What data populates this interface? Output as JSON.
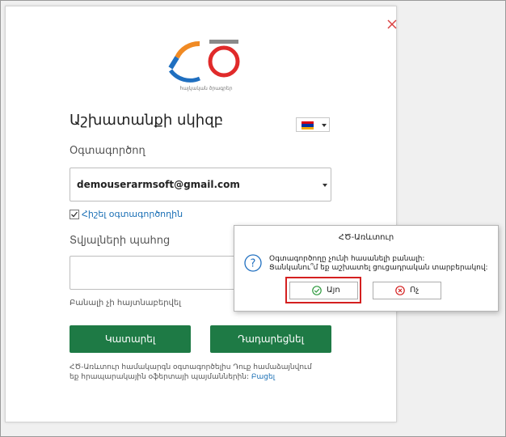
{
  "login": {
    "title": "Աշխատանքի սկիզբ",
    "user_label": "Օգտագործող",
    "user_value": "demouserarmsoft@gmail.com",
    "remember_label": "Հիշել օգտագործողին",
    "remember_checked": true,
    "password_label": "Տվյալների պահոց",
    "password_value": "",
    "hint": "Բանալի չի հայտնաբերվել",
    "login_button": "Կատարել",
    "connect_button": "Դադարեցնել",
    "footer_text": "ՀԾ-Առևտուր համակարգն օգտագործելիս Դուք համաձայնվում եք հրապարակային օֆերտայի պայմաններին:",
    "footer_link": "Բացել"
  },
  "logo": {
    "tagline": "հայկական ծրագրեր",
    "colors": {
      "orange": "#f08a24",
      "blue": "#1f6fc0",
      "red": "#e02a2a",
      "gray": "#8a8a8a"
    }
  },
  "language": {
    "flag_colors": [
      "#d90012",
      "#0033a0",
      "#f2a800"
    ]
  },
  "dialog": {
    "title": "ՀԾ-Առևտուր",
    "message_line1": "Օգտագործողը չունի հասանելի բանալի:",
    "message_line2": "Ցանկանու՞մ եք աշխատել ցուցադրական տարբերակով:",
    "yes_label": "Այո",
    "no_label": "Ոչ"
  },
  "colors": {
    "accent_green": "#1e7a45",
    "link_blue": "#1a6fb5",
    "close_red": "#d94040",
    "highlight_red": "#d42020"
  }
}
